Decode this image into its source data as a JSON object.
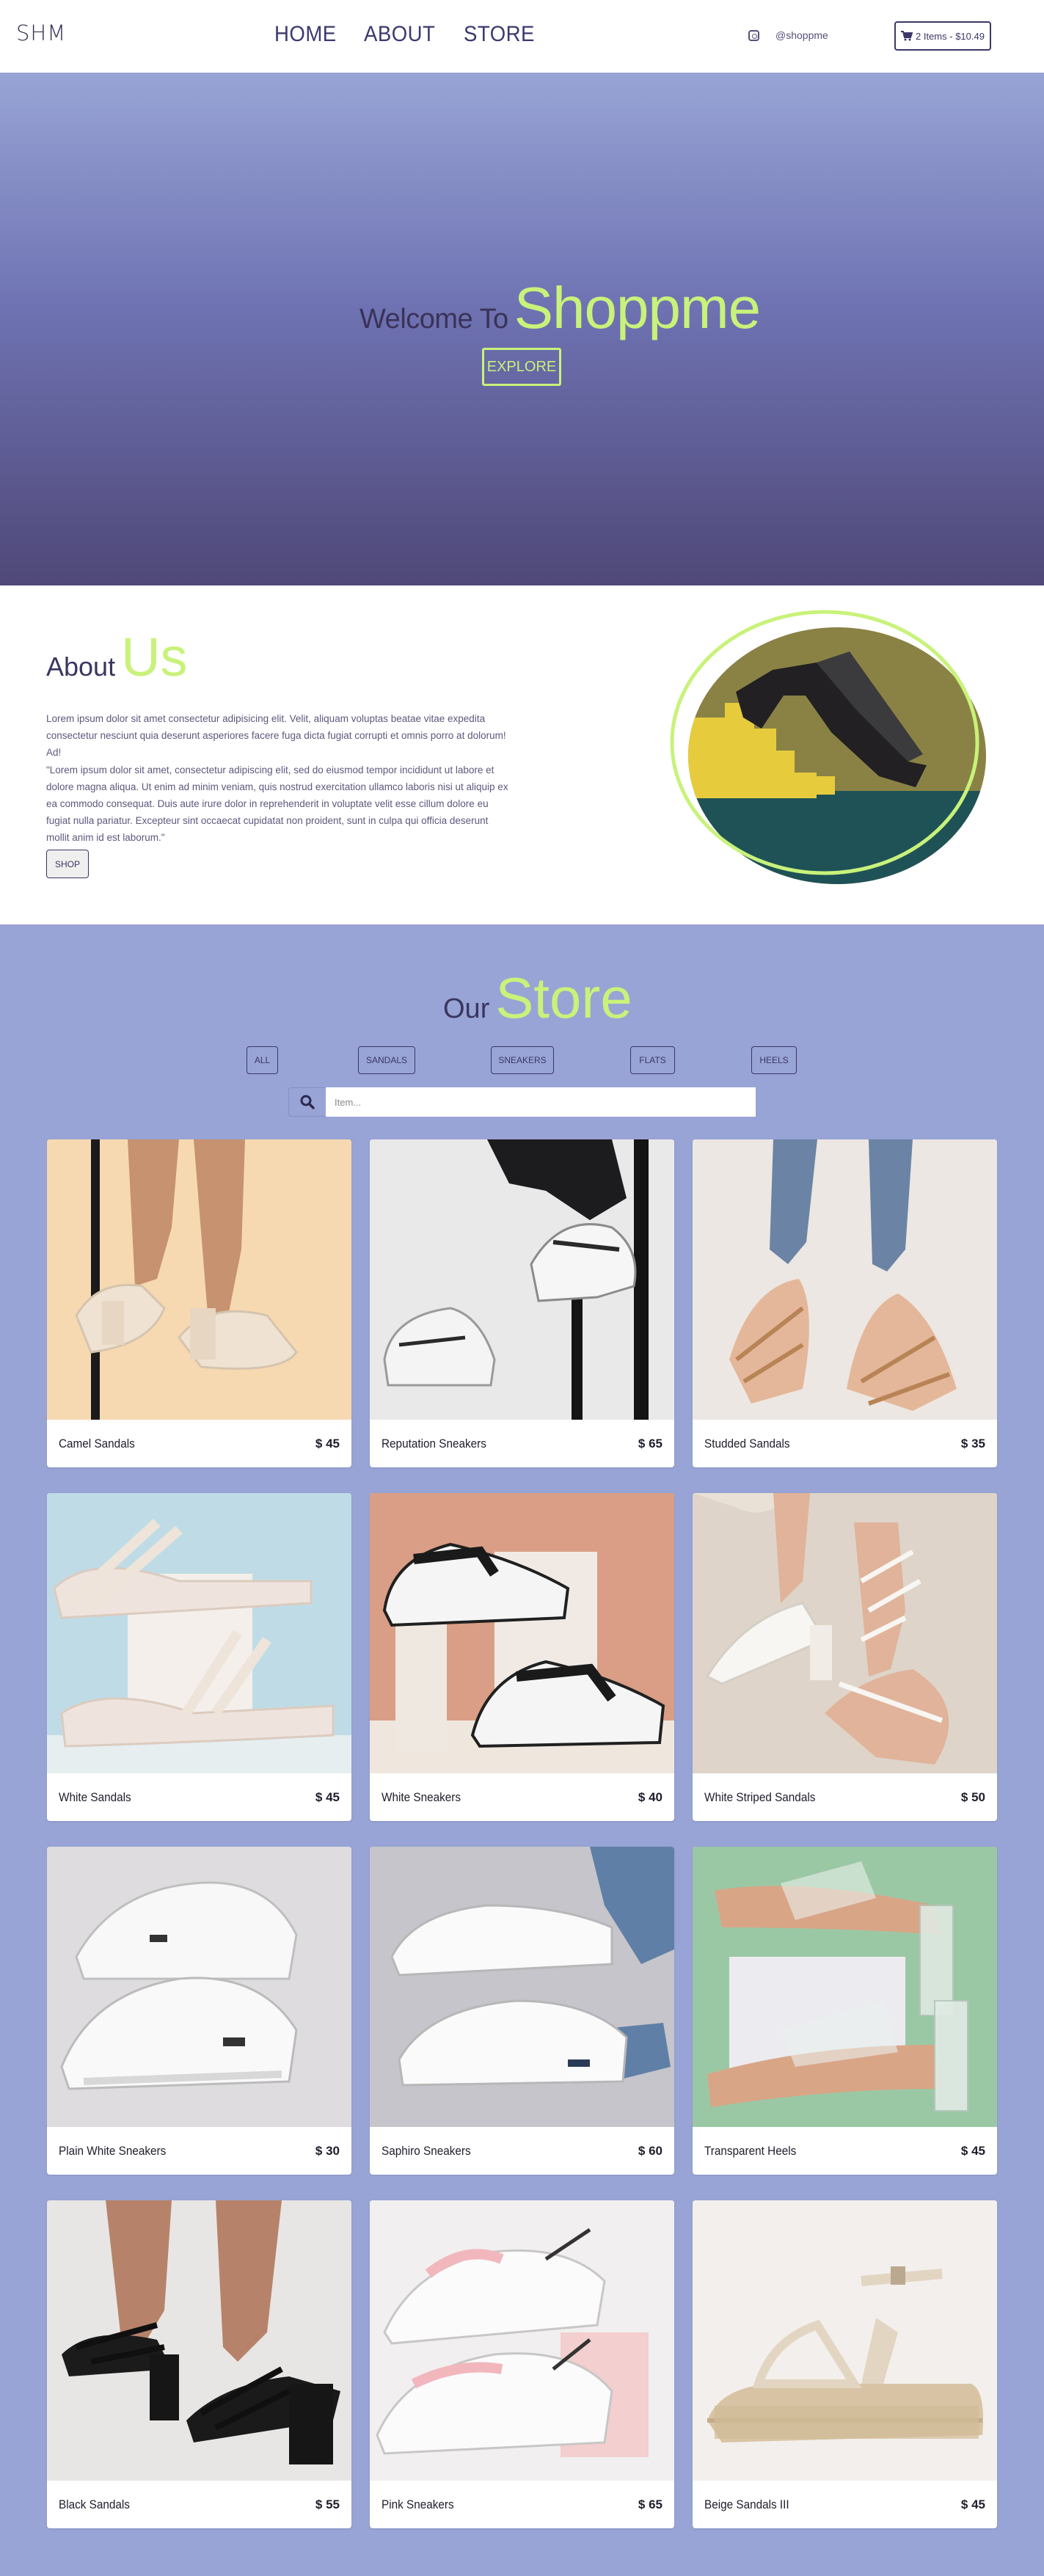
{
  "nav": {
    "logo": "SHM",
    "links": [
      "HOME",
      "ABOUT",
      "STORE"
    ],
    "social_handle": "@shoppme",
    "cart_label": "2 Items - $10.49"
  },
  "hero": {
    "welcome": "Welcome To",
    "brand": "Shoppme",
    "button": "EXPLORE"
  },
  "about": {
    "title_a": "About",
    "title_b": "Us",
    "paragraph1": "Lorem ipsum dolor sit amet consectetur adipisicing elit. Velit, aliquam voluptas beatae vitae expedita consectetur nesciunt quia deserunt asperiores facere fuga dicta fugiat corrupti et omnis porro at dolorum! Ad!",
    "paragraph2": "\"Lorem ipsum dolor sit amet, consectetur adipiscing elit, sed do eiusmod tempor incididunt ut labore et dolore magna aliqua. Ut enim ad minim veniam, quis nostrud exercitation ullamco laboris nisi ut aliquip ex ea commodo consequat. Duis aute irure dolor in reprehenderit in voluptate velit esse cillum dolore eu fugiat nulla pariatur. Excepteur sint occaecat cupidatat non proident, sunt in culpa qui officia deserunt mollit anim id est laborum.\"",
    "button": "SHOP"
  },
  "store": {
    "title_a": "Our",
    "title_b": "Store",
    "filters": [
      "ALL",
      "SANDALS",
      "SNEAKERS",
      "FLATS",
      "HEELS"
    ],
    "search_placeholder": "Item...",
    "products": [
      {
        "name": "Camel Sandals",
        "price": "$ 45"
      },
      {
        "name": "Reputation Sneakers",
        "price": "$ 65"
      },
      {
        "name": "Studded Sandals",
        "price": "$ 35"
      },
      {
        "name": "White Sandals",
        "price": "$ 45"
      },
      {
        "name": "White Sneakers",
        "price": "$ 40"
      },
      {
        "name": "White Striped Sandals",
        "price": "$ 50"
      },
      {
        "name": "Plain White Sneakers",
        "price": "$ 30"
      },
      {
        "name": "Saphiro Sneakers",
        "price": "$ 60"
      },
      {
        "name": "Transparent Heels",
        "price": "$ 45"
      },
      {
        "name": "Black Sandals",
        "price": "$ 55"
      },
      {
        "name": "Pink Sneakers",
        "price": "$ 65"
      },
      {
        "name": "Beige Sandals III",
        "price": "$ 45"
      }
    ]
  },
  "colors": {
    "accent": "#c8f27a",
    "primary": "#3b3768",
    "store_bg": "#98a4d5"
  }
}
